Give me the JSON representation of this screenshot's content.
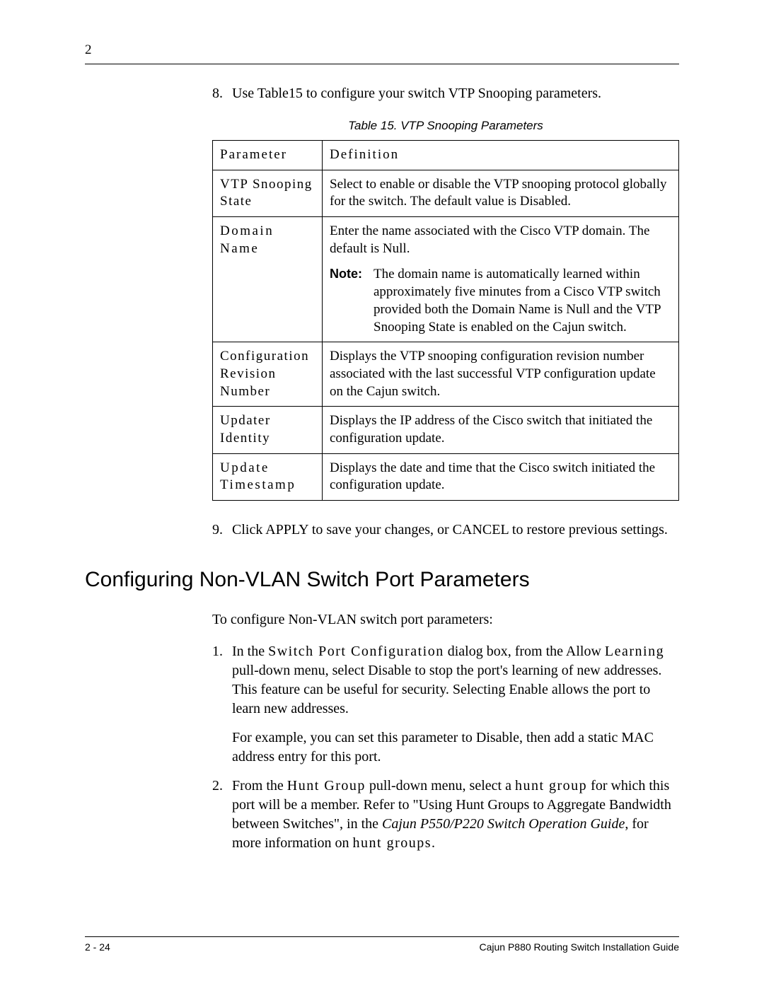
{
  "header": {
    "chapter_number": "2"
  },
  "step8": {
    "number": "8.",
    "text": "Use Table15 to configure your switch VTP Snooping parameters."
  },
  "table_caption": "Table 15.  VTP Snooping Parameters",
  "table_headers": {
    "param": "Parameter",
    "def": "Definition"
  },
  "rows": {
    "r0": {
      "param": "VTP Snooping State",
      "def": "Select to enable or disable the VTP snooping protocol globally for the switch. The default value is Disabled."
    },
    "r1": {
      "param": "Domain Name",
      "def_main": "Enter the name associated with the Cisco VTP domain. The default is Null.",
      "note_label": "Note:",
      "note_text": "The domain name is automatically learned within approximately five minutes from a Cisco VTP switch provided both the Domain Name is Null and the VTP Snooping State is enabled on the Cajun switch."
    },
    "r2": {
      "param": "Configuration Revision Number",
      "def": "Displays the VTP snooping configuration revision number associated with the last successful VTP configuration update on the Cajun switch."
    },
    "r3": {
      "param": "Updater Identity",
      "def": "Displays the IP address of the Cisco switch that initiated the configuration update."
    },
    "r4": {
      "param": "Update Timestamp",
      "def": "Displays the date and time that the Cisco switch initiated the configuration update."
    }
  },
  "step9": {
    "number": "9.",
    "text": "Click APPLY to save your changes, or CANCEL to restore previous settings."
  },
  "section_heading": "Configuring Non-VLAN Switch Port Parameters",
  "intro_line": "To configure Non-VLAN switch port parameters:",
  "step1": {
    "number": "1.",
    "seg_a": "In the ",
    "seg_b_spaced": "Switch Port Configuration",
    "seg_c": " dialog box, from the Allow ",
    "seg_d_spaced": "Learning",
    "seg_e": " pull-down menu, select Disable to stop the port's learning of new addresses. This feature can be useful for security. Selecting Enable allows the port to learn new addresses.",
    "para2": "For example, you can set this parameter to Disable, then add a static MAC address entry for this port."
  },
  "step2": {
    "number": "2.",
    "seg_a": "From the ",
    "seg_b_spaced": "Hunt Group",
    "seg_c": " pull-down menu, select a ",
    "seg_d_spaced": "hunt group",
    "seg_e": " for which this port will be a member. Refer to \"Using Hunt Groups to Aggregate Bandwidth between Switches\", in the ",
    "seg_f_italic": "Cajun P550/P220 Switch Operation Guide",
    "seg_g": ", for more information on ",
    "seg_h_spaced": "hunt groups",
    "seg_i": "."
  },
  "footer": {
    "page_label": "2 - 24",
    "doc_title": "Cajun P880 Routing Switch Installation Guide"
  },
  "chart_data": {
    "type": "table",
    "title": "Table 15. VTP Snooping Parameters",
    "columns": [
      "Parameter",
      "Definition"
    ],
    "rows": [
      [
        "VTP Snooping State",
        "Select to enable or disable the VTP snooping protocol globally for the switch. The default value is Disabled."
      ],
      [
        "Domain Name",
        "Enter the name associated with the Cisco VTP domain. The default is Null. Note: The domain name is automatically learned within approximately five minutes from a Cisco VTP switch provided both the Domain Name is Null and the VTP Snooping State is enabled on the Cajun switch."
      ],
      [
        "Configuration Revision Number",
        "Displays the VTP snooping configuration revision number associated with the last successful VTP configuration update on the Cajun switch."
      ],
      [
        "Updater Identity",
        "Displays the IP address of the Cisco switch that initiated the configuration update."
      ],
      [
        "Update Timestamp",
        "Displays the date and time that the Cisco switch initiated the configuration update."
      ]
    ]
  }
}
